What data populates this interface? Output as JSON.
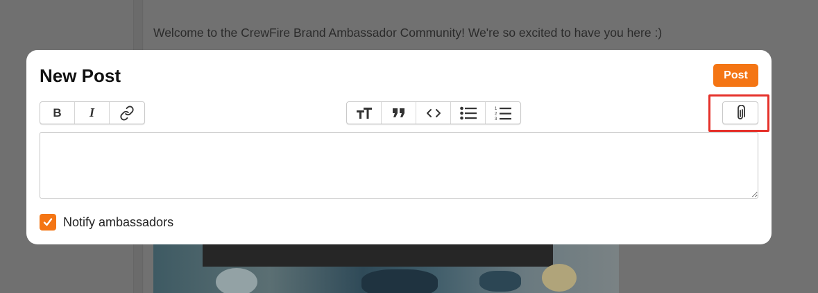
{
  "background": {
    "welcome_text": "Welcome to the CrewFire Brand Ambassador Community! We're so excited to have you here :)"
  },
  "modal": {
    "title": "New Post",
    "post_label": "Post",
    "editor_value": "",
    "notify_label": "Notify ambassadors",
    "notify_checked": true
  },
  "toolbar": {
    "format_group": [
      {
        "icon": "bold-icon",
        "label": "B"
      },
      {
        "icon": "italic-icon",
        "label": "I"
      },
      {
        "icon": "link-icon"
      }
    ],
    "block_group": [
      {
        "icon": "heading-icon"
      },
      {
        "icon": "quote-icon"
      },
      {
        "icon": "code-icon"
      },
      {
        "icon": "bullet-list-icon"
      },
      {
        "icon": "numbered-list-icon"
      }
    ],
    "attach_group": [
      {
        "icon": "paperclip-icon"
      }
    ]
  },
  "colors": {
    "accent": "#f47514",
    "highlight": "#e5312a"
  }
}
